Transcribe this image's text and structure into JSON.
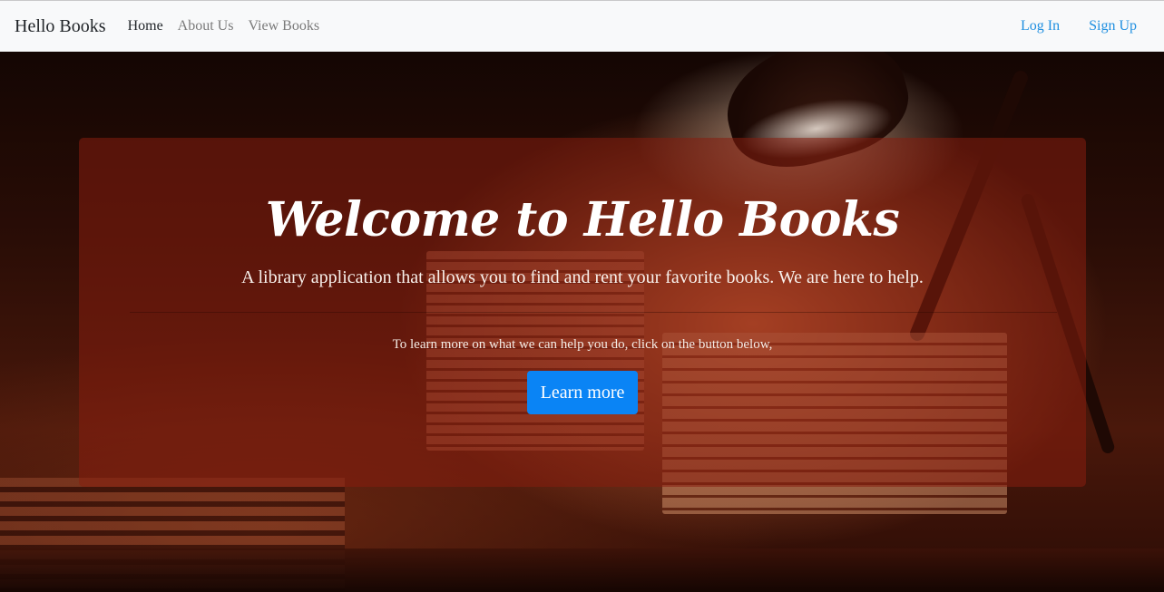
{
  "navbar": {
    "brand": "Hello Books",
    "links": [
      {
        "label": "Home",
        "active": true
      },
      {
        "label": "About Us",
        "active": false
      },
      {
        "label": "View Books",
        "active": false
      }
    ],
    "auth": {
      "login": "Log In",
      "signup": "Sign Up"
    }
  },
  "hero": {
    "title": "Welcome to Hello Books",
    "lead": "A library application that allows you to find and rent your favorite books. We are here to help.",
    "text": "To learn more on what we can help you do, click on the button below,",
    "button": "Learn more"
  },
  "colors": {
    "navbar_bg": "#f8f9fa",
    "auth_link": "#1f8fe0",
    "button_bg": "#0a84f5",
    "jumbotron_bg": "rgba(135,30,15,0.55)"
  }
}
